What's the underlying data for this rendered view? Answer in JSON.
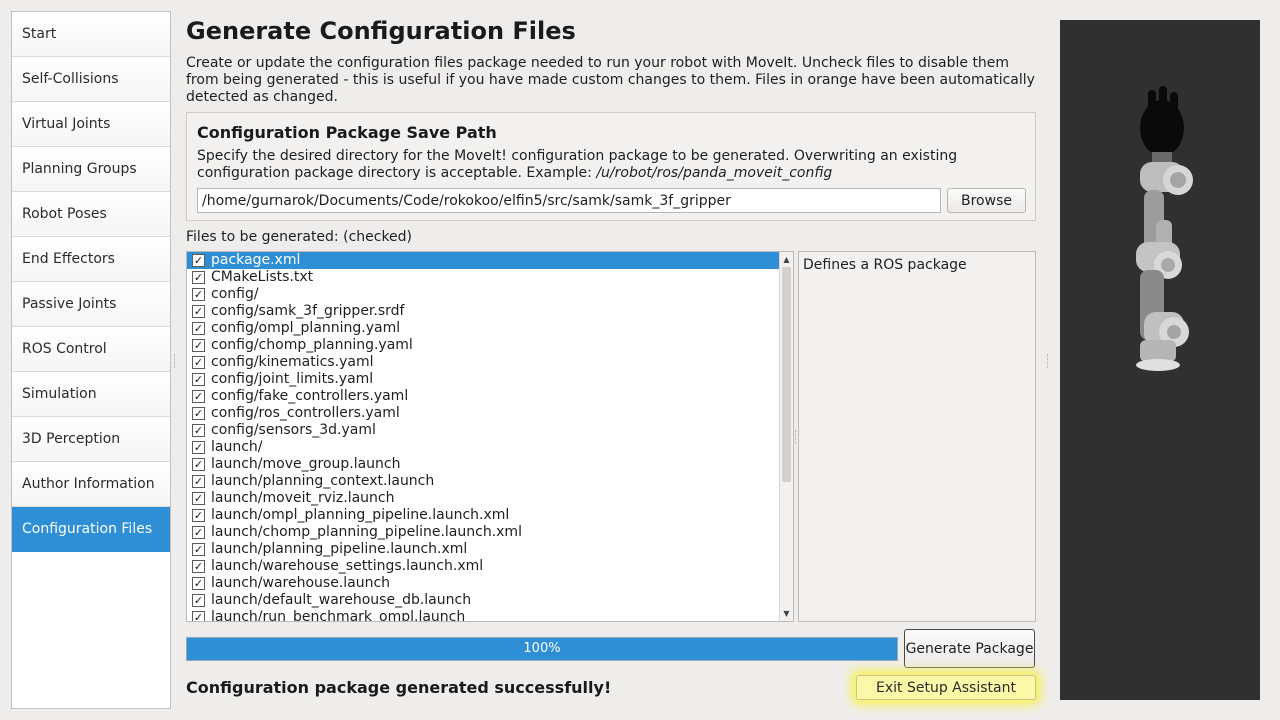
{
  "sidebar": {
    "items": [
      {
        "label": "Start"
      },
      {
        "label": "Self-Collisions"
      },
      {
        "label": "Virtual Joints"
      },
      {
        "label": "Planning Groups"
      },
      {
        "label": "Robot Poses"
      },
      {
        "label": "End Effectors"
      },
      {
        "label": "Passive Joints"
      },
      {
        "label": "ROS Control"
      },
      {
        "label": "Simulation"
      },
      {
        "label": "3D Perception"
      },
      {
        "label": "Author Information"
      },
      {
        "label": "Configuration Files"
      }
    ],
    "selected_index": 11
  },
  "main": {
    "title": "Generate Configuration Files",
    "description": "Create or update the configuration files package needed to run your robot with MoveIt. Uncheck files to disable them from being generated - this is useful if you have made custom changes to them. Files in orange have been automatically detected as changed."
  },
  "save_path": {
    "title": "Configuration Package Save Path",
    "description": "Specify the desired directory for the MoveIt! configuration package to be generated. Overwriting an existing configuration package directory is acceptable. Example: ",
    "example": "/u/robot/ros/panda_moveit_config",
    "value": "/home/gurnarok/Documents/Code/rokokoo/elfin5/src/samk/samk_3f_gripper",
    "browse_label": "Browse"
  },
  "files": {
    "label": "Files to be generated: (checked)",
    "check_glyph": "✓",
    "selected_index": 0,
    "items": [
      "package.xml",
      "CMakeLists.txt",
      "config/",
      "config/samk_3f_gripper.srdf",
      "config/ompl_planning.yaml",
      "config/chomp_planning.yaml",
      "config/kinematics.yaml",
      "config/joint_limits.yaml",
      "config/fake_controllers.yaml",
      "config/ros_controllers.yaml",
      "config/sensors_3d.yaml",
      "launch/",
      "launch/move_group.launch",
      "launch/planning_context.launch",
      "launch/moveit_rviz.launch",
      "launch/ompl_planning_pipeline.launch.xml",
      "launch/chomp_planning_pipeline.launch.xml",
      "launch/planning_pipeline.launch.xml",
      "launch/warehouse_settings.launch.xml",
      "launch/warehouse.launch",
      "launch/default_warehouse_db.launch",
      "launch/run_benchmark_ompl.launch"
    ],
    "selected_description": "Defines a ROS package"
  },
  "progress": {
    "value": 100,
    "label": "100%"
  },
  "generate_label": "Generate Package",
  "status_message": "Configuration package generated successfully!",
  "exit_label": "Exit Setup Assistant",
  "colors": {
    "accent": "#2e8fd6",
    "highlight": "#f7f15a",
    "viewer_bg": "#303030"
  }
}
